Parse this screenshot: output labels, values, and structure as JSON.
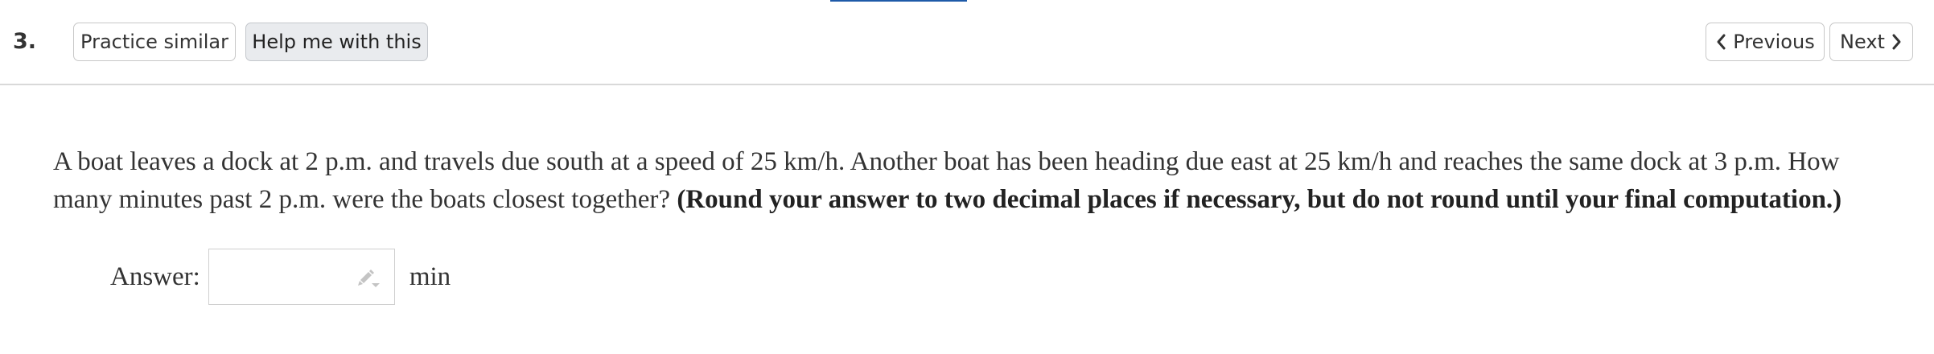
{
  "header": {
    "question_number": "3.",
    "practice_label": "Practice similar",
    "help_label": "Help me with this",
    "previous_label": "Previous",
    "next_label": "Next"
  },
  "icons": {
    "previous": "chevron-left-icon",
    "next": "chevron-right-icon",
    "answer_entry": "pencil-icon"
  },
  "problem": {
    "text": "A boat leaves a dock at 2 p.m. and travels due south at a speed of 25 km/h. Another boat has been heading due east at 25 km/h and reaches the same dock at 3 p.m. How many minutes past 2 p.m. were the boats closest together?",
    "instruction": "(Round your answer to two decimal places if necessary, but do not round until your final computation.)"
  },
  "answer": {
    "label": "Answer:",
    "value": "",
    "unit": "min"
  },
  "colors": {
    "accent_line": "#1e5aa8",
    "help_button_bg": "#e9ebee",
    "divider": "#d9d9d9"
  }
}
